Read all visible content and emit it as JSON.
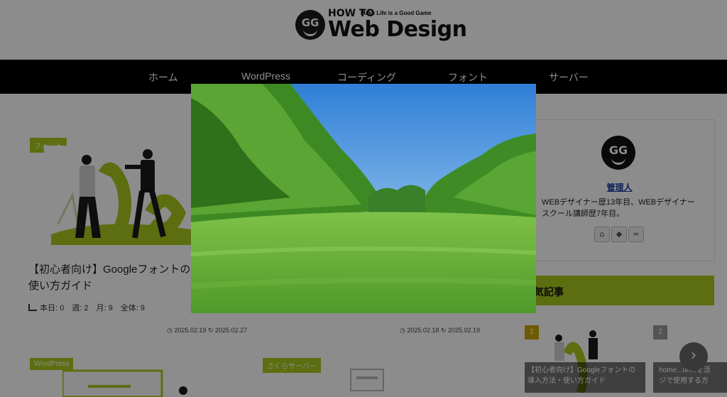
{
  "header": {
    "logo": {
      "mark": "GG",
      "howto": "HOW TO",
      "tagline": "Make Life is a Good Game",
      "main": "Web Design"
    }
  },
  "nav": {
    "items": [
      {
        "label": "ホーム"
      },
      {
        "label": "WordPress"
      },
      {
        "label": "コーディング"
      },
      {
        "label": "フォント"
      },
      {
        "label": "サーバー"
      }
    ]
  },
  "articles": [
    {
      "category": "フォント",
      "title_line1": "【初心者向け】Googleフォントの導",
      "title_line2": "使い方ガイド",
      "stats": "本日: 0　週: 2　月: 9　全体: 9",
      "date_published": "2025.02.19",
      "date_updated": "2025.02.27"
    },
    {
      "date_published": "2025.02.18",
      "date_updated": "2025.02.19"
    },
    {
      "category": "WordPress"
    },
    {
      "category": "さくらサーバー"
    }
  ],
  "sidebar": {
    "profile": {
      "avatar_mark": "GG",
      "name": "管理人",
      "description": "WEBデザイナー歴13年目、WEBデザイナースクール講師歴7年目。",
      "social_icons": [
        "home-icon",
        "feedly-icon",
        "rss-icon"
      ]
    },
    "popular": {
      "title": "人気記事",
      "items": [
        {
          "rank": "1",
          "caption": "【初心者向け】Googleフォントの導入方法・使い方ガイド"
        },
        {
          "rank": "2",
          "caption": "home...url...を活\nジで使用する方"
        }
      ]
    }
  },
  "colors": {
    "accent": "#a8c81e",
    "nav_bg": "#000000",
    "overlay": "rgba(0,0,0,0.45)",
    "admin_link": "#1a3fa5"
  },
  "modal": {
    "image_subject": "green park with trees and lawn under blue sky"
  }
}
